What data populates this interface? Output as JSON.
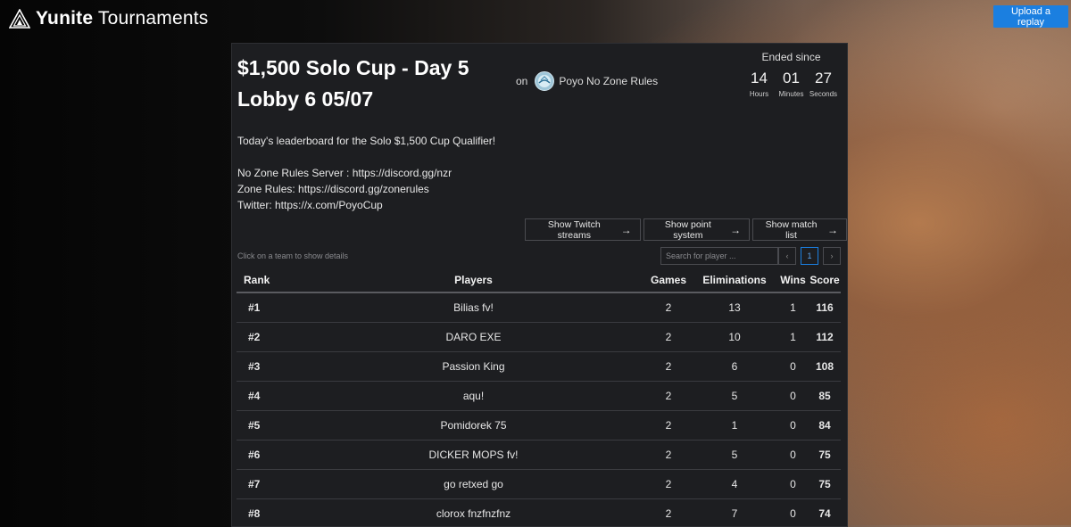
{
  "header": {
    "brand_bold": "Yunite",
    "brand_rest": " Tournaments",
    "upload_label": "Upload a replay",
    "accent_color": "#1b7fe0"
  },
  "tournament": {
    "title": "$1,500 Solo Cup - Day 5 Lobby 6 05/07",
    "on_label": "on",
    "organizer": "Poyo No Zone Rules"
  },
  "status": {
    "label": "Ended since",
    "countdown": [
      {
        "value": "14",
        "unit": "Hours"
      },
      {
        "value": "01",
        "unit": "Minutes"
      },
      {
        "value": "27",
        "unit": "Seconds"
      }
    ]
  },
  "description": {
    "intro": "Today's leaderboard for the Solo $1,500 Cup Qualifier!",
    "lines": [
      "No Zone Rules Server : https://discord.gg/nzr",
      "Zone Rules: https://discord.gg/zonerules",
      "Twitter: https://x.com/PoyoCup"
    ]
  },
  "actions": [
    {
      "label": "Show Twitch streams",
      "icon": "arrow-right-icon"
    },
    {
      "label": "Show point system",
      "icon": "arrow-right-icon"
    },
    {
      "label": "Show match list",
      "icon": "arrow-right-icon"
    }
  ],
  "leaderboard": {
    "hint": "Click on a team to show details",
    "search_placeholder": "Search for player ...",
    "pagination": {
      "prev": "‹",
      "current": "1",
      "next": "›"
    },
    "columns": {
      "rank": "Rank",
      "players": "Players",
      "games": "Games",
      "eliminations": "Eliminations",
      "wins": "Wins",
      "score": "Score"
    },
    "rows": [
      {
        "rank": "#1",
        "player": "Bilias fv!",
        "games": "2",
        "eliminations": "13",
        "wins": "1",
        "score": "116"
      },
      {
        "rank": "#2",
        "player": "DARO EXE",
        "games": "2",
        "eliminations": "10",
        "wins": "1",
        "score": "112"
      },
      {
        "rank": "#3",
        "player": "Passion King",
        "games": "2",
        "eliminations": "6",
        "wins": "0",
        "score": "108"
      },
      {
        "rank": "#4",
        "player": "aqu!",
        "games": "2",
        "eliminations": "5",
        "wins": "0",
        "score": "85"
      },
      {
        "rank": "#5",
        "player": "Pomidorek 75",
        "games": "2",
        "eliminations": "1",
        "wins": "0",
        "score": "84"
      },
      {
        "rank": "#6",
        "player": "DICKER MOPS fv!",
        "games": "2",
        "eliminations": "5",
        "wins": "0",
        "score": "75"
      },
      {
        "rank": "#7",
        "player": "go retxed go",
        "games": "2",
        "eliminations": "4",
        "wins": "0",
        "score": "75"
      },
      {
        "rank": "#8",
        "player": "clorox fnzfnzfnz",
        "games": "2",
        "eliminations": "7",
        "wins": "0",
        "score": "74"
      }
    ]
  }
}
